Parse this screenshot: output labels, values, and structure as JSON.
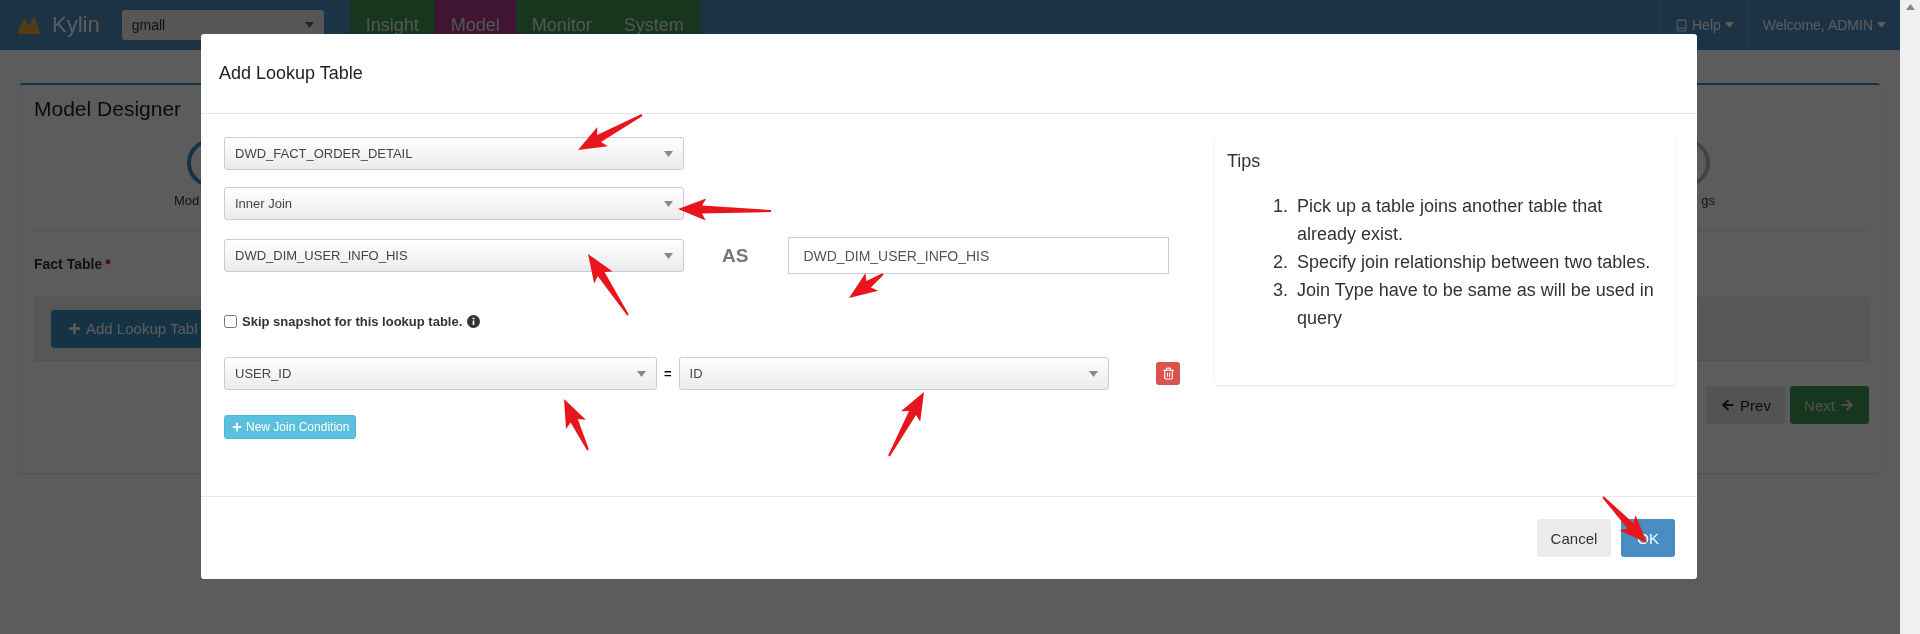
{
  "navbar": {
    "brand": "Kylin",
    "project": "gmall",
    "tabs": [
      {
        "label": "Insight",
        "selected": false
      },
      {
        "label": "Model",
        "selected": true
      },
      {
        "label": "Monitor",
        "selected": false
      },
      {
        "label": "System",
        "selected": false
      }
    ],
    "help": "Help",
    "user": "Welcome, ADMIN"
  },
  "page": {
    "title": "Model Designer",
    "steps": [
      {
        "label": "Mod"
      },
      {
        "label": "gs"
      }
    ],
    "fact_table_label": "Fact Table",
    "required_mark": "*",
    "add_lookup_button": "Add Lookup Tabl",
    "prev_button": "Prev",
    "next_button": "Next"
  },
  "dialog": {
    "title": "Add Lookup Table",
    "fact_table_select": "DWD_FACT_ORDER_DETAIL",
    "join_type_select": "Inner Join",
    "lookup_table_select": "DWD_DIM_USER_INFO_HIS",
    "as_label": "AS",
    "alias_field": {
      "value": "DWD_DIM_USER_INFO_HIS"
    },
    "skip_snapshot": {
      "label": "Skip snapshot for this lookup table.",
      "checked": false
    },
    "join_conditions": [
      {
        "left": "USER_ID",
        "operator": "=",
        "right": "ID"
      }
    ],
    "new_join_condition_button": "New Join Condition",
    "tips": {
      "title": "Tips",
      "items": [
        {
          "number": "1.",
          "text": "Pick up a table joins another table that already exist."
        },
        {
          "number": "2.",
          "text": "Specify join relationship between two tables."
        },
        {
          "number": "3.",
          "text": "Join Type have to be same as will be used in query"
        }
      ]
    },
    "buttons": [
      {
        "label": "Cancel",
        "kind": "default"
      },
      {
        "label": "OK",
        "kind": "primary"
      }
    ]
  }
}
